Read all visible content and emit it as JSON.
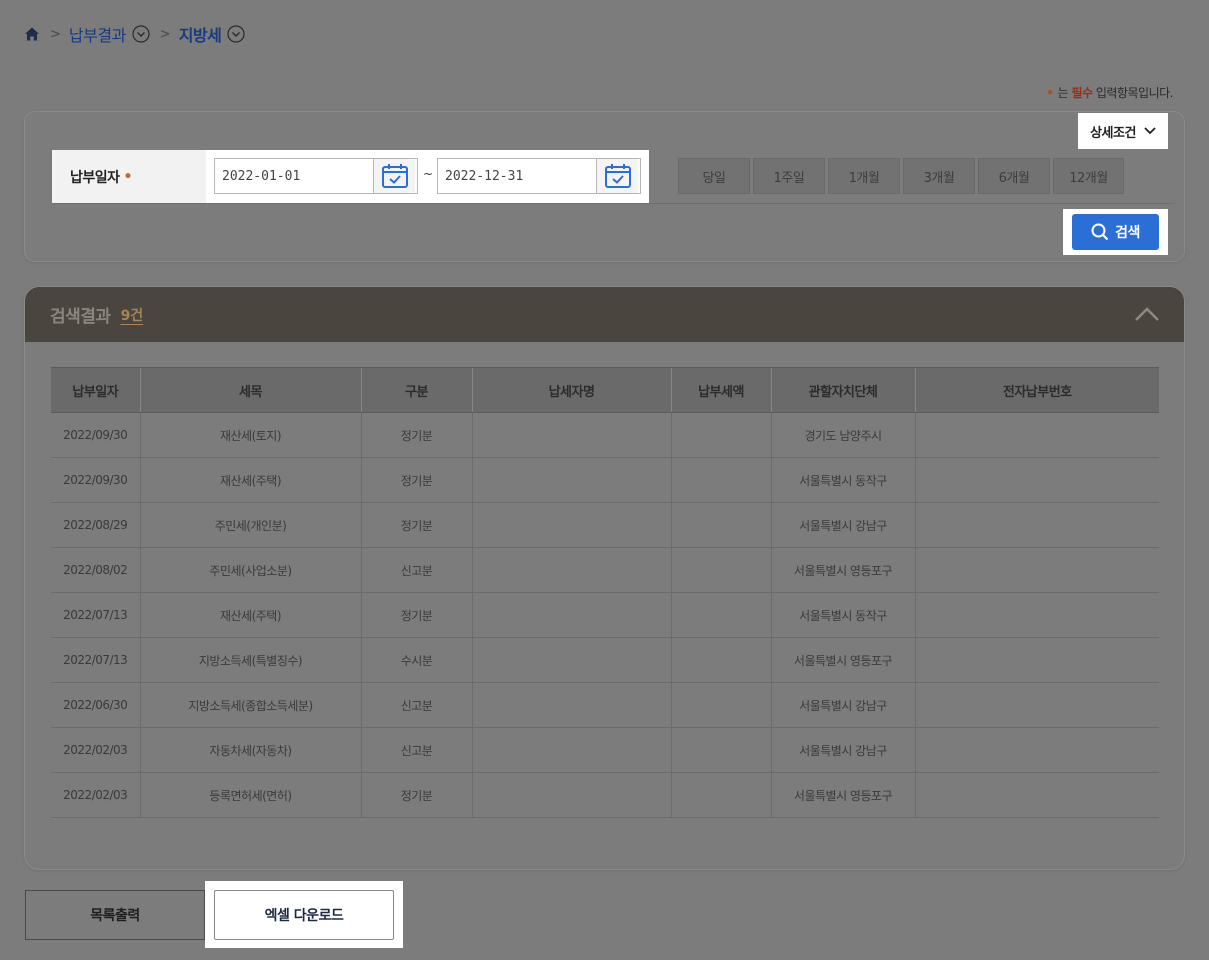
{
  "breadcrumb": {
    "home_icon": "home-icon",
    "level1": "납부결과",
    "level2": "지방세"
  },
  "required_note": {
    "dot": "•",
    "prefix": "는",
    "required": "필수",
    "suffix": "입력항목입니다."
  },
  "search": {
    "detail_toggle_label": "상세조건",
    "date_label": "납부일자",
    "required_dot": "•",
    "start_date": "2022-01-01",
    "end_date": "2022-12-31",
    "separator": "~",
    "period_buttons": [
      "당일",
      "1주일",
      "1개월",
      "3개월",
      "6개월",
      "12개월"
    ],
    "search_button": "검색"
  },
  "results": {
    "title": "검색결과",
    "count": "9건",
    "columns": [
      "납부일자",
      "세목",
      "구분",
      "납세자명",
      "납부세액",
      "관할자치단체",
      "전자납부번호"
    ],
    "rows": [
      [
        "2022/09/30",
        "재산세(토지)",
        "정기분",
        "",
        "",
        "경기도 남양주시",
        ""
      ],
      [
        "2022/09/30",
        "재산세(주택)",
        "정기분",
        "",
        "",
        "서울특별시 동작구",
        ""
      ],
      [
        "2022/08/29",
        "주민세(개인분)",
        "정기분",
        "",
        "",
        "서울특별시 강남구",
        ""
      ],
      [
        "2022/08/02",
        "주민세(사업소분)",
        "신고분",
        "",
        "",
        "서울특별시 영등포구",
        ""
      ],
      [
        "2022/07/13",
        "재산세(주택)",
        "정기분",
        "",
        "",
        "서울특별시 동작구",
        ""
      ],
      [
        "2022/07/13",
        "지방소득세(특별징수)",
        "수시분",
        "",
        "",
        "서울특별시 영등포구",
        ""
      ],
      [
        "2022/06/30",
        "지방소득세(종합소득세분)",
        "신고분",
        "",
        "",
        "서울특별시 강남구",
        ""
      ],
      [
        "2022/02/03",
        "자동차세(자동차)",
        "신고분",
        "",
        "",
        "서울특별시 강남구",
        ""
      ],
      [
        "2022/02/03",
        "등록면허세(면허)",
        "정기분",
        "",
        "",
        "서울특별시 영등포구",
        ""
      ]
    ]
  },
  "actions": {
    "print_list": "목록출력",
    "excel_download": "엑셀 다운로드"
  }
}
